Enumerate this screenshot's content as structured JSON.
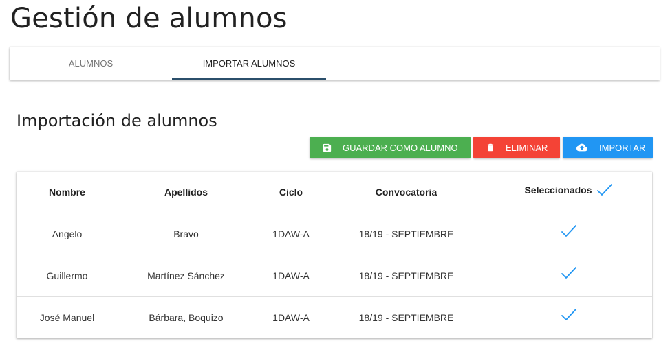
{
  "page": {
    "title": "Gestión de alumnos"
  },
  "tabs": [
    {
      "label": "ALUMNOS",
      "active": false
    },
    {
      "label": "IMPORTAR ALUMNOS",
      "active": true
    }
  ],
  "section": {
    "title": "Importación de alumnos"
  },
  "toolbar": {
    "save_label": "GUARDAR COMO ALUMNO",
    "save_icon": "floppy-disk-icon",
    "save_color": "#4caf50",
    "delete_label": "ELIMINAR",
    "delete_icon": "trash-icon",
    "delete_color": "#f44336",
    "import_label": "IMPORTAR",
    "import_icon": "cloud-upload-icon",
    "import_color": "#2196f3"
  },
  "table": {
    "columns": [
      "Nombre",
      "Apellidos",
      "Ciclo",
      "Convocatoria",
      "Seleccionados"
    ],
    "select_all_icon": "check-icon",
    "check_color": "#2196f3",
    "rows": [
      {
        "nombre": "Angelo",
        "apellidos": "Bravo",
        "ciclo": "1DAW-A",
        "convocatoria": "18/19 - SEPTIEMBRE",
        "selected": true
      },
      {
        "nombre": "Guillermo",
        "apellidos": "Martínez Sánchez",
        "ciclo": "1DAW-A",
        "convocatoria": "18/19 - SEPTIEMBRE",
        "selected": true
      },
      {
        "nombre": "José Manuel",
        "apellidos": "Bárbara, Boquizo",
        "ciclo": "1DAW-A",
        "convocatoria": "18/19 - SEPTIEMBRE",
        "selected": true
      }
    ]
  }
}
